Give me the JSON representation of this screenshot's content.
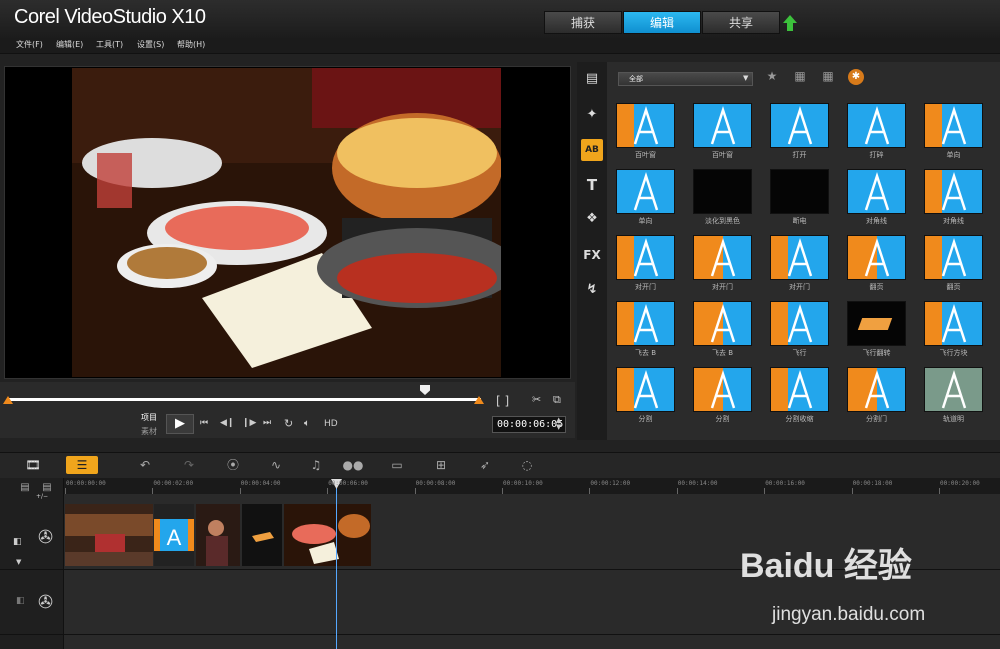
{
  "app": {
    "title": "Corel VideoStudio X10"
  },
  "mode_tabs": [
    "捕获",
    "编辑",
    "共享"
  ],
  "active_mode": "编辑",
  "menu": [
    "文件(F)",
    "编辑(E)",
    "工具(T)",
    "设置(S)",
    "帮助(H)"
  ],
  "player": {
    "mode_project": "项目",
    "mode_clip": "素材",
    "hd_label": "HD",
    "timecode": "00:00:06:05",
    "trim_brackets": "[ ]"
  },
  "library": {
    "filter": "全部",
    "transitions": [
      {
        "label": "百叶窗",
        "style": "blinds-orange"
      },
      {
        "label": "百叶窗",
        "style": "blinds-stripes"
      },
      {
        "label": "打开",
        "style": "diamond"
      },
      {
        "label": "打碎",
        "style": "shatter"
      },
      {
        "label": "单向",
        "style": "split-orange"
      },
      {
        "label": "单向",
        "style": "half-right"
      },
      {
        "label": "淡化到黑色",
        "style": "black"
      },
      {
        "label": "断电",
        "style": "black"
      },
      {
        "label": "对角线",
        "style": "diagonal-blue"
      },
      {
        "label": "对角线",
        "style": "diagonal-orange"
      },
      {
        "label": "对开门",
        "style": "doors"
      },
      {
        "label": "对开门",
        "style": "doors-orange"
      },
      {
        "label": "对开门",
        "style": "doors-mid"
      },
      {
        "label": "翻页",
        "style": "page"
      },
      {
        "label": "翻页",
        "style": "page-curl"
      },
      {
        "label": "飞去 B",
        "style": "fly-b"
      },
      {
        "label": "飞去 B",
        "style": "fly-b2"
      },
      {
        "label": "飞行",
        "style": "fly"
      },
      {
        "label": "飞行翻转",
        "style": "flip-black"
      },
      {
        "label": "飞行方块",
        "style": "fly-box"
      },
      {
        "label": "分割",
        "style": "split-a"
      },
      {
        "label": "分割",
        "style": "split-b"
      },
      {
        "label": "分割收缩",
        "style": "split-shrink"
      },
      {
        "label": "分割门",
        "style": "split-door"
      },
      {
        "label": "轨道明",
        "style": "gray"
      }
    ]
  },
  "timeline": {
    "ruler": [
      "00:00:00:00",
      "00:00:02:00",
      "00:00:04:00",
      "00:00:06:00",
      "00:00:08:00",
      "00:00:10:00",
      "00:00:12:00",
      "00:00:14:00",
      "00:00:16:00",
      "00:00:18:00",
      "00:00:20:00"
    ],
    "add_track": "+/−"
  },
  "watermark": {
    "brand": "Baidu 经验",
    "url": "jingyan.baidu.com"
  },
  "colors": {
    "accent": "#1ba0e2",
    "transition_orange": "#f08a1c",
    "transition_blue": "#23a6ec"
  }
}
